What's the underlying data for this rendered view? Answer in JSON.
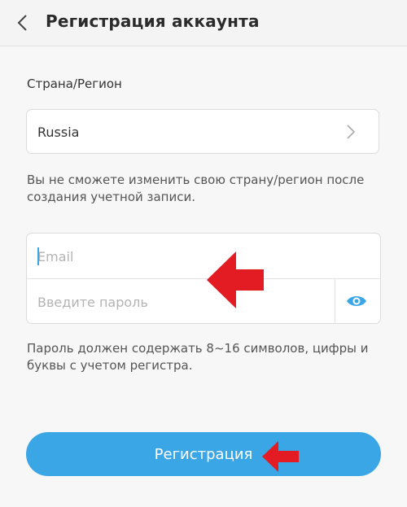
{
  "header": {
    "back_icon": "chevron-left-icon",
    "title": "Регистрация аккаунта"
  },
  "country": {
    "label": "Страна/Регион",
    "value": "Russia",
    "note": "Вы не сможете изменить свою страну/регион после создания учетной записи."
  },
  "credentials": {
    "email_placeholder": "Email",
    "email_value": "",
    "password_placeholder": "Введите пароль",
    "password_value": "",
    "password_toggle_icon": "eye-icon",
    "password_note": "Пароль должен содержать 8~16 символов, цифры и буквы с учетом регистра."
  },
  "register_button": {
    "label": "Регистрация"
  },
  "colors": {
    "accent": "#3aa6e6",
    "annotation_arrow": "#e31b23"
  }
}
